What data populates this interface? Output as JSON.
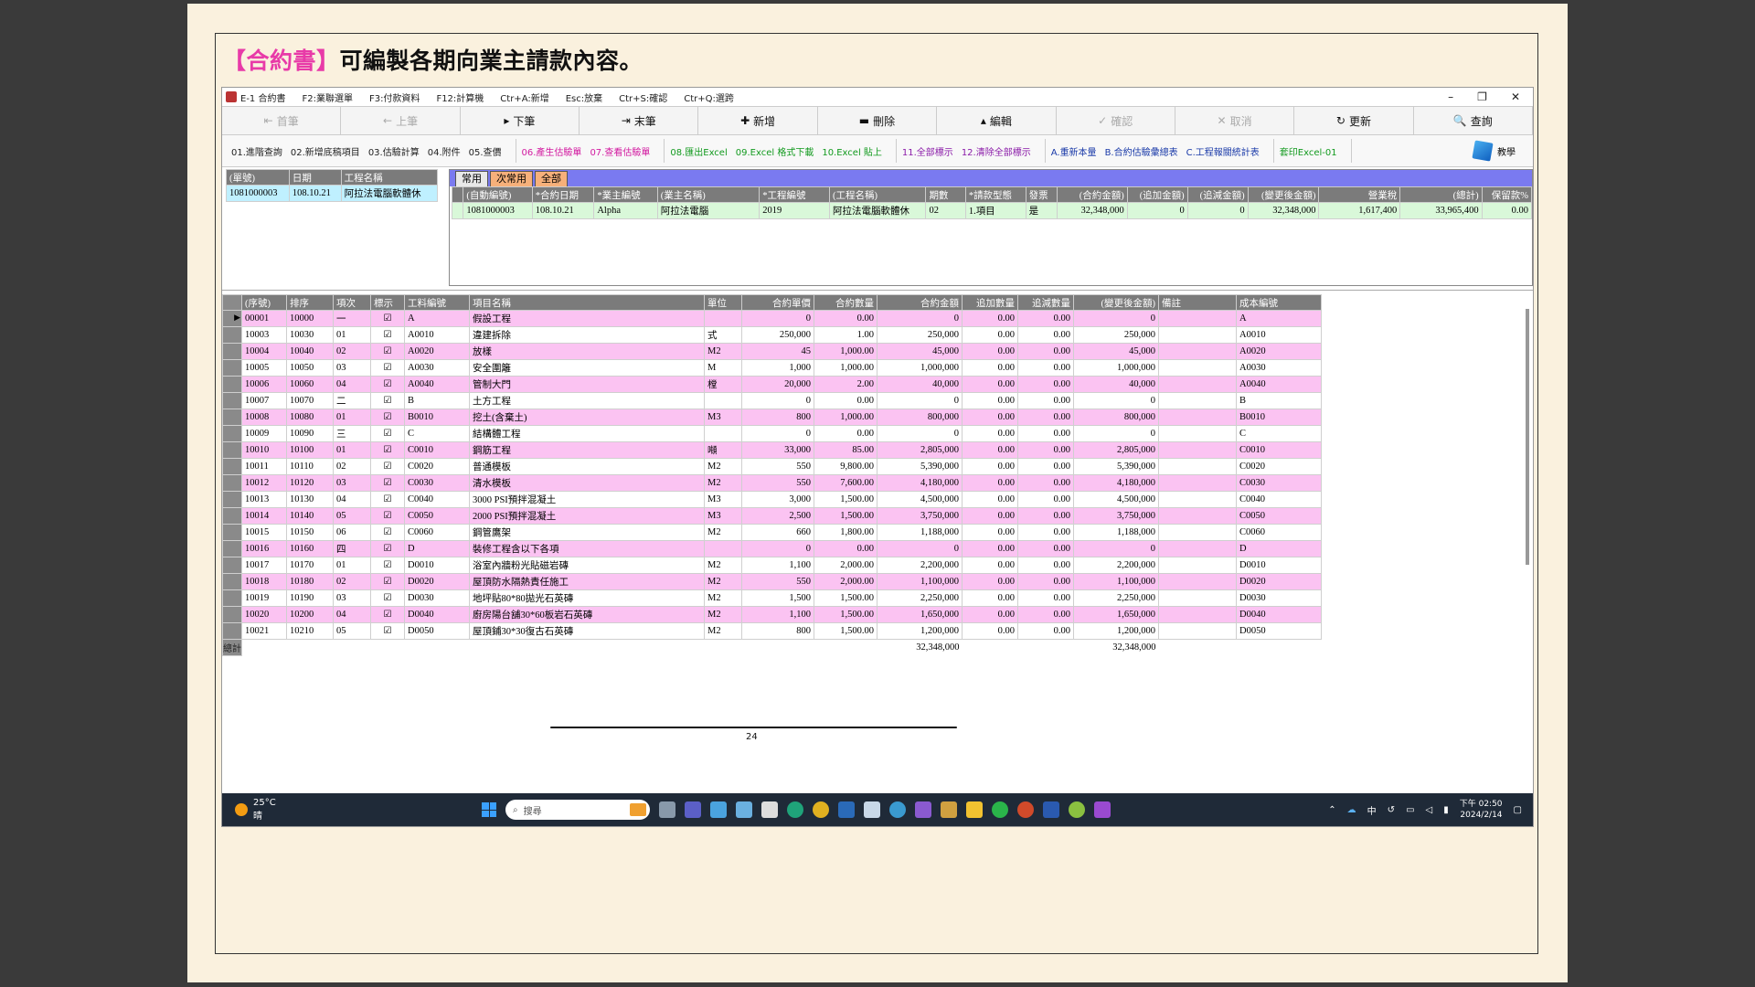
{
  "slide": {
    "heading_highlight": "【合約書】",
    "heading_rest": "可編製各期向業主請款內容。",
    "page_number": "24"
  },
  "titlebar": {
    "app_title": "E-1 合約書",
    "shortcuts": [
      "F2:業聯選單",
      "F3:付款資料",
      "F12:計算機",
      "Ctr+A:新增",
      "Esc:放棄",
      "Ctr+S:確認",
      "Ctr+Q:選跨"
    ]
  },
  "nav": [
    "首筆",
    "上筆",
    "下筆",
    "末筆",
    "新增",
    "刪除",
    "編輯",
    "確認",
    "取消",
    "更新",
    "查詢"
  ],
  "funcbar": {
    "g1": [
      "01.進階查詢",
      "02.新增底稿項目",
      "03.估驗計算",
      "04.附件",
      "05.查價"
    ],
    "g2": [
      "06.產生估驗單",
      "07.查看估驗單"
    ],
    "g3": [
      "08.匯出Excel",
      "09.Excel 格式下載",
      "10.Excel 貼上"
    ],
    "g4": [
      "11.全部標示",
      "12.清除全部標示"
    ],
    "g5": [
      "A.重新本量",
      "B.合約估驗彙總表",
      "C.工程報關統計表"
    ],
    "g6": [
      "套印Excel-01"
    ],
    "teach": "教學"
  },
  "left_grid": {
    "headers": [
      "(單號)",
      "日期",
      "工程名稱"
    ],
    "row": [
      "1081000003",
      "108.10.21",
      "阿拉法電腦軟體休"
    ]
  },
  "tabs": [
    "常用",
    "次常用",
    "全部"
  ],
  "top_grid": {
    "headers": [
      "(自動編號)",
      "*合約日期",
      "*業主編號",
      "(業主名稱)",
      "*工程編號",
      "(工程名稱)",
      "期數",
      "*請款型態",
      "發票",
      "(合約金額)",
      "(追加金額)",
      "(追減金額)",
      "(變更後金額)",
      "營業稅",
      "(總計)",
      "保留款%"
    ],
    "row": [
      "1081000003",
      "108.10.21",
      "Alpha",
      "阿拉法電腦",
      "2019",
      "阿拉法電腦軟體休",
      "02",
      "1.項目",
      "是",
      "32,348,000",
      "0",
      "0",
      "32,348,000",
      "1,617,400",
      "33,965,400",
      "0.00"
    ]
  },
  "detail_grid": {
    "headers": [
      "(序號)",
      "排序",
      "項次",
      "標示",
      "工料編號",
      "項目名稱",
      "單位",
      "合約單價",
      "合約數量",
      "合約金額",
      "追加數量",
      "追減數量",
      "(變更後金額)",
      "備註",
      "成本編號"
    ],
    "rows": [
      [
        "00001",
        "10000",
        "一",
        "☑",
        "A",
        "假設工程",
        "",
        "0",
        "0.00",
        "0",
        "0.00",
        "0.00",
        "0",
        "",
        "A"
      ],
      [
        "10003",
        "10030",
        "01",
        "☑",
        "A0010",
        "違建拆除",
        "式",
        "250,000",
        "1.00",
        "250,000",
        "0.00",
        "0.00",
        "250,000",
        "",
        "A0010"
      ],
      [
        "10004",
        "10040",
        "02",
        "☑",
        "A0020",
        "放樣",
        "M2",
        "45",
        "1,000.00",
        "45,000",
        "0.00",
        "0.00",
        "45,000",
        "",
        "A0020"
      ],
      [
        "10005",
        "10050",
        "03",
        "☑",
        "A0030",
        "安全圍籬",
        "M",
        "1,000",
        "1,000.00",
        "1,000,000",
        "0.00",
        "0.00",
        "1,000,000",
        "",
        "A0030"
      ],
      [
        "10006",
        "10060",
        "04",
        "☑",
        "A0040",
        "管制大門",
        "樘",
        "20,000",
        "2.00",
        "40,000",
        "0.00",
        "0.00",
        "40,000",
        "",
        "A0040"
      ],
      [
        "10007",
        "10070",
        "二",
        "☑",
        "B",
        "土方工程",
        "",
        "0",
        "0.00",
        "0",
        "0.00",
        "0.00",
        "0",
        "",
        "B"
      ],
      [
        "10008",
        "10080",
        "01",
        "☑",
        "B0010",
        "挖土(含棄土)",
        "M3",
        "800",
        "1,000.00",
        "800,000",
        "0.00",
        "0.00",
        "800,000",
        "",
        "B0010"
      ],
      [
        "10009",
        "10090",
        "三",
        "☑",
        "C",
        "結構體工程",
        "",
        "0",
        "0.00",
        "0",
        "0.00",
        "0.00",
        "0",
        "",
        "C"
      ],
      [
        "10010",
        "10100",
        "01",
        "☑",
        "C0010",
        "鋼筋工程",
        "噸",
        "33,000",
        "85.00",
        "2,805,000",
        "0.00",
        "0.00",
        "2,805,000",
        "",
        "C0010"
      ],
      [
        "10011",
        "10110",
        "02",
        "☑",
        "C0020",
        "普通模板",
        "M2",
        "550",
        "9,800.00",
        "5,390,000",
        "0.00",
        "0.00",
        "5,390,000",
        "",
        "C0020"
      ],
      [
        "10012",
        "10120",
        "03",
        "☑",
        "C0030",
        "清水模板",
        "M2",
        "550",
        "7,600.00",
        "4,180,000",
        "0.00",
        "0.00",
        "4,180,000",
        "",
        "C0030"
      ],
      [
        "10013",
        "10130",
        "04",
        "☑",
        "C0040",
        "3000 PSI預拌混凝土",
        "M3",
        "3,000",
        "1,500.00",
        "4,500,000",
        "0.00",
        "0.00",
        "4,500,000",
        "",
        "C0040"
      ],
      [
        "10014",
        "10140",
        "05",
        "☑",
        "C0050",
        "2000 PSI預拌混凝土",
        "M3",
        "2,500",
        "1,500.00",
        "3,750,000",
        "0.00",
        "0.00",
        "3,750,000",
        "",
        "C0050"
      ],
      [
        "10015",
        "10150",
        "06",
        "☑",
        "C0060",
        "鋼管鷹架",
        "M2",
        "660",
        "1,800.00",
        "1,188,000",
        "0.00",
        "0.00",
        "1,188,000",
        "",
        "C0060"
      ],
      [
        "10016",
        "10160",
        "四",
        "☑",
        "D",
        "裝修工程含以下各項",
        "",
        "0",
        "0.00",
        "0",
        "0.00",
        "0.00",
        "0",
        "",
        "D"
      ],
      [
        "10017",
        "10170",
        "01",
        "☑",
        "D0010",
        "浴室內牆粉光貼磁岩磚",
        "M2",
        "1,100",
        "2,000.00",
        "2,200,000",
        "0.00",
        "0.00",
        "2,200,000",
        "",
        "D0010"
      ],
      [
        "10018",
        "10180",
        "02",
        "☑",
        "D0020",
        "屋頂防水隔熱責任施工",
        "M2",
        "550",
        "2,000.00",
        "1,100,000",
        "0.00",
        "0.00",
        "1,100,000",
        "",
        "D0020"
      ],
      [
        "10019",
        "10190",
        "03",
        "☑",
        "D0030",
        "地坪貼80*80拋光石英磚",
        "M2",
        "1,500",
        "1,500.00",
        "2,250,000",
        "0.00",
        "0.00",
        "2,250,000",
        "",
        "D0030"
      ],
      [
        "10020",
        "10200",
        "04",
        "☑",
        "D0040",
        "廚房陽台舖30*60板岩石英磚",
        "M2",
        "1,100",
        "1,500.00",
        "1,650,000",
        "0.00",
        "0.00",
        "1,650,000",
        "",
        "D0040"
      ],
      [
        "10021",
        "10210",
        "05",
        "☑",
        "D0050",
        "屋頂鋪30*30復古石英磚",
        "M2",
        "800",
        "1,500.00",
        "1,200,000",
        "0.00",
        "0.00",
        "1,200,000",
        "",
        "D0050"
      ]
    ],
    "total_label": "總計",
    "total_contract": "32,348,000",
    "total_changed": "32,348,000"
  },
  "taskbar": {
    "temp": "25°C",
    "weather": "晴",
    "search": "搜尋",
    "ime": "中",
    "time": "下午 02:50",
    "date": "2024/2/14"
  }
}
